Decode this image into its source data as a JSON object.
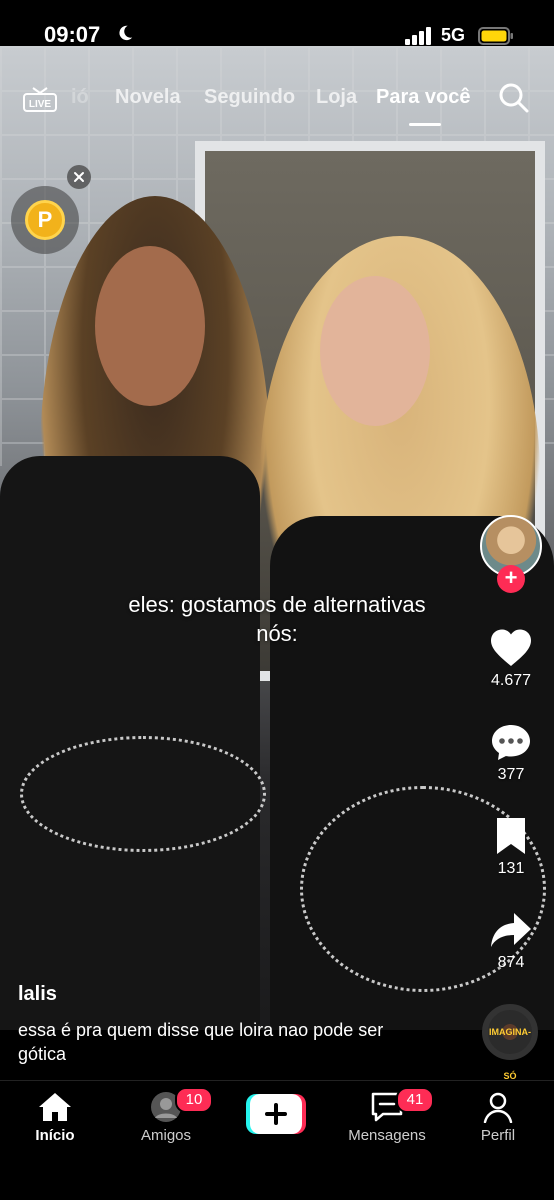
{
  "status_bar": {
    "time": "09:07",
    "network": "5G"
  },
  "top_nav": {
    "tabs": [
      {
        "label": "ió",
        "active": false
      },
      {
        "label": "Novela",
        "active": false
      },
      {
        "label": "Seguindo",
        "active": false
      },
      {
        "label": "Loja",
        "active": false
      },
      {
        "label": "Para você",
        "active": true
      }
    ]
  },
  "coin": {
    "symbol": "P"
  },
  "video": {
    "caption_line1": "eles: gostamos de alternativas",
    "caption_line2": "nós:"
  },
  "actions": {
    "likes": "4.677",
    "comments": "377",
    "saves": "131",
    "shares": "874"
  },
  "post": {
    "author": "lalis",
    "description": "essa é pra quem disse que loira nao pode ser gótica"
  },
  "music_disc": {
    "text": "IMAGINA-SÓ"
  },
  "bottom_nav": {
    "items": [
      {
        "label": "Início"
      },
      {
        "label": "Amigos",
        "badge": "10"
      },
      {
        "label": "Mensagens",
        "badge": "41"
      },
      {
        "label": "Perfil"
      }
    ]
  },
  "colors": {
    "accent": "#fe2c55",
    "coin": "#f2b21b",
    "battery": "#ffd60a"
  }
}
